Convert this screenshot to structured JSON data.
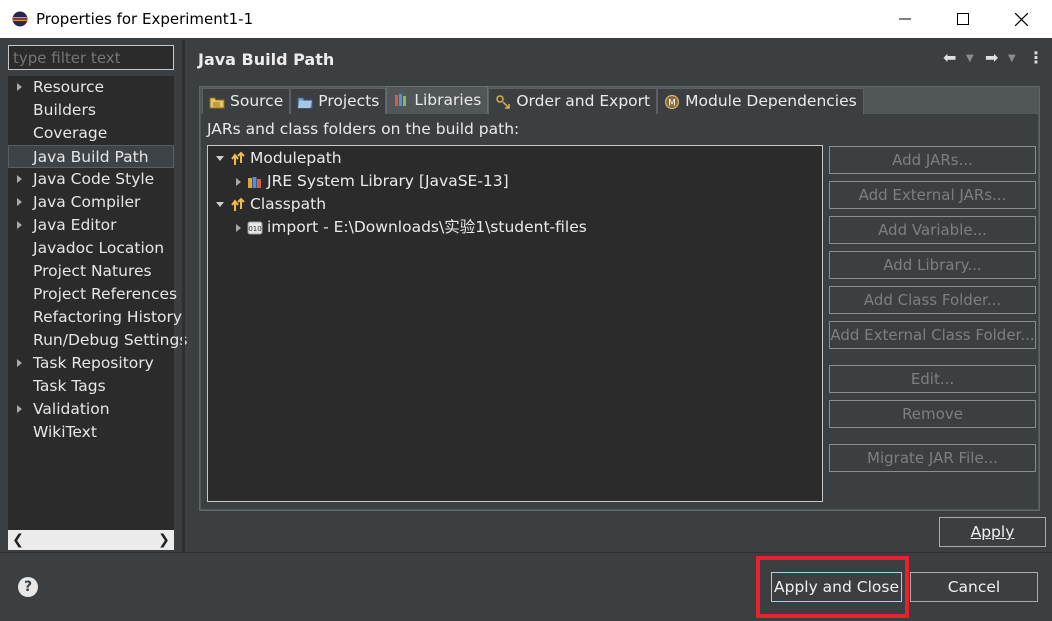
{
  "window": {
    "title": "Properties for Experiment1-1",
    "minimize_label": "—",
    "maximize_label": "☐",
    "close_label": "✕"
  },
  "left_pane": {
    "filter_placeholder": "type filter text",
    "items": [
      {
        "label": "Resource",
        "expandable": true
      },
      {
        "label": "Builders",
        "expandable": false
      },
      {
        "label": "Coverage",
        "expandable": false
      },
      {
        "label": "Java Build Path",
        "expandable": false,
        "selected": true
      },
      {
        "label": "Java Code Style",
        "expandable": true
      },
      {
        "label": "Java Compiler",
        "expandable": true
      },
      {
        "label": "Java Editor",
        "expandable": true
      },
      {
        "label": "Javadoc Location",
        "expandable": false
      },
      {
        "label": "Project Natures",
        "expandable": false
      },
      {
        "label": "Project References",
        "expandable": false
      },
      {
        "label": "Refactoring History",
        "expandable": false
      },
      {
        "label": "Run/Debug Settings",
        "expandable": false
      },
      {
        "label": "Task Repository",
        "expandable": true
      },
      {
        "label": "Task Tags",
        "expandable": false
      },
      {
        "label": "Validation",
        "expandable": true
      },
      {
        "label": "WikiText",
        "expandable": false
      }
    ]
  },
  "page": {
    "title": "Java Build Path",
    "tabs": [
      {
        "label": "Source",
        "icon": "source-folder-icon"
      },
      {
        "label": "Projects",
        "icon": "projects-icon"
      },
      {
        "label": "Libraries",
        "icon": "libraries-icon",
        "active": true
      },
      {
        "label": "Order and Export",
        "icon": "order-export-icon"
      },
      {
        "label": "Module Dependencies",
        "icon": "module-icon"
      }
    ],
    "section_label": "JARs and class folders on the build path:",
    "tree": [
      {
        "label": "Modulepath",
        "level": 0,
        "expanded": true,
        "icon": "modulepath-icon"
      },
      {
        "label": "JRE System Library [JavaSE-13]",
        "level": 1,
        "expanded": false,
        "icon": "library-icon"
      },
      {
        "label": "Classpath",
        "level": 0,
        "expanded": true,
        "icon": "classpath-icon"
      },
      {
        "label": "import - E:\\Downloads\\实验1\\student-files",
        "level": 1,
        "expanded": false,
        "icon": "class-folder-icon"
      }
    ],
    "side_buttons": {
      "add_jars": "Add JARs...",
      "add_external_jars": "Add External JARs...",
      "add_variable": "Add Variable...",
      "add_library": "Add Library...",
      "add_class_folder": "Add Class Folder...",
      "add_external_class_folder": "Add External Class Folder...",
      "edit": "Edit...",
      "remove": "Remove",
      "migrate_jar": "Migrate JAR File..."
    },
    "apply_label": "Apply"
  },
  "footer": {
    "help_label": "?",
    "apply_close_label": "Apply and Close",
    "cancel_label": "Cancel"
  },
  "colors": {
    "background": "#3c3f41",
    "tree_background": "#2b2b2b",
    "highlight": "#e8212c"
  }
}
